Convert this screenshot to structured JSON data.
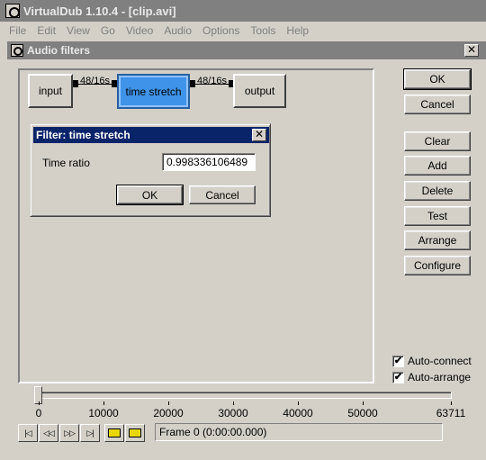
{
  "main_window": {
    "title": "VirtualDub 1.10.4 - [clip.avi]",
    "menu": [
      "File",
      "Edit",
      "View",
      "Go",
      "Video",
      "Audio",
      "Options",
      "Tools",
      "Help"
    ]
  },
  "audio_filters_dialog": {
    "title": "Audio filters",
    "close_glyph": "✕",
    "graph": {
      "nodes": {
        "input": "input",
        "time_stretch": "time stretch",
        "output": "output"
      },
      "edges": {
        "input_to_stretch": "48/16s",
        "stretch_to_output": "48/16s"
      }
    },
    "buttons": {
      "ok": "OK",
      "cancel": "Cancel",
      "clear": "Clear",
      "add": "Add",
      "delete": "Delete",
      "test": "Test",
      "arrange": "Arrange",
      "configure": "Configure"
    },
    "checkboxes": {
      "auto_connect": {
        "label": "Auto-connect",
        "checked": true,
        "mark": "✔"
      },
      "auto_arrange": {
        "label": "Auto-arrange",
        "checked": true,
        "mark": "✔"
      }
    }
  },
  "filter_dialog": {
    "title": "Filter: time stretch",
    "close_glyph": "✕",
    "time_ratio_label": "Time ratio",
    "time_ratio_value": "0.998336106489",
    "ok": "OK",
    "cancel": "Cancel"
  },
  "timeline": {
    "position": 0,
    "max": 63711,
    "tick_labels": [
      "0",
      "10000",
      "20000",
      "30000",
      "40000",
      "50000",
      "63711"
    ],
    "frame_status": "Frame 0 (0:00:00.000)",
    "transport_icons": [
      "go-start-icon",
      "prev-frame-icon",
      "next-frame-icon",
      "go-end-icon",
      "prev-keyframe-icon",
      "next-keyframe-icon"
    ],
    "transport_glyphs": [
      "|◁",
      "◁◁",
      "▷▷",
      "▷|"
    ]
  },
  "colors": {
    "face": "#d4d0c8",
    "inactive_title": "#808080",
    "active_title": "#0a246a",
    "selected_node": "#3f93e8"
  }
}
